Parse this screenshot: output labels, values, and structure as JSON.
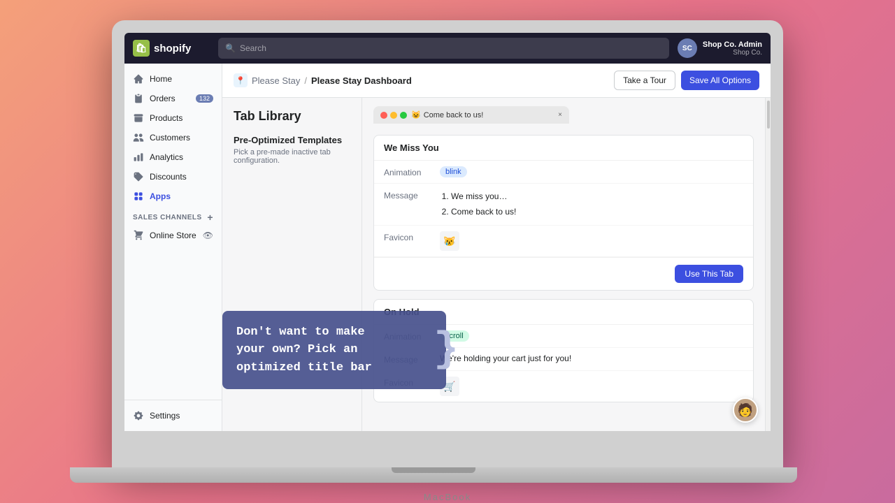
{
  "laptop": {
    "brand": "MacBook"
  },
  "topbar": {
    "logo_text": "shopify",
    "logo_icon": "🛍",
    "search_placeholder": "Search",
    "user_initials": "SC",
    "user_name": "Shop Co. Admin",
    "user_shop": "Shop Co."
  },
  "sidebar": {
    "nav_items": [
      {
        "id": "home",
        "label": "Home",
        "icon": "home"
      },
      {
        "id": "orders",
        "label": "Orders",
        "icon": "orders",
        "badge": "132"
      },
      {
        "id": "products",
        "label": "Products",
        "icon": "products"
      },
      {
        "id": "customers",
        "label": "Customers",
        "icon": "customers"
      },
      {
        "id": "analytics",
        "label": "Analytics",
        "icon": "analytics"
      },
      {
        "id": "discounts",
        "label": "Discounts",
        "icon": "discounts"
      },
      {
        "id": "apps",
        "label": "Apps",
        "icon": "apps",
        "active": true
      }
    ],
    "sales_channels_label": "SALES CHANNELS",
    "online_store_label": "Online Store",
    "settings_label": "Settings"
  },
  "header": {
    "app_icon": "📍",
    "breadcrumb_parent": "Please Stay",
    "breadcrumb_sep": "/",
    "breadcrumb_current": "Please Stay Dashboard",
    "btn_tour": "Take a Tour",
    "btn_save": "Save All Options"
  },
  "page": {
    "title": "Tab Library",
    "templates_heading": "Pre-Optimized Templates",
    "templates_desc": "Pick a pre-made inactive tab configuration."
  },
  "browser_preview": {
    "emoji": "😺",
    "tab_label": "Come back to us!",
    "close_symbol": "×"
  },
  "tab_cards": [
    {
      "id": "we-miss-you",
      "title": "We Miss You",
      "animation_label": "Animation",
      "animation_badge": "blink",
      "animation_badge_type": "blue",
      "message_label": "Message",
      "messages": [
        "We miss you…",
        "Come back to us!"
      ],
      "favicon_label": "Favicon",
      "favicon_emoji": "😿",
      "btn_label": "Use This Tab"
    },
    {
      "id": "on-hold",
      "title": "On Hold",
      "animation_label": "Animation",
      "animation_badge": "scroll",
      "animation_badge_type": "green",
      "message_label": "Message",
      "messages": [
        "We're holding your cart just for you!"
      ],
      "favicon_label": "Favicon",
      "favicon_emoji": "🛒",
      "btn_label": "Use This Tab"
    }
  ],
  "overlay": {
    "line1": "Don't want to make",
    "line2": "your own? Pick an",
    "line3": "optimized title bar",
    "brace": "}"
  }
}
